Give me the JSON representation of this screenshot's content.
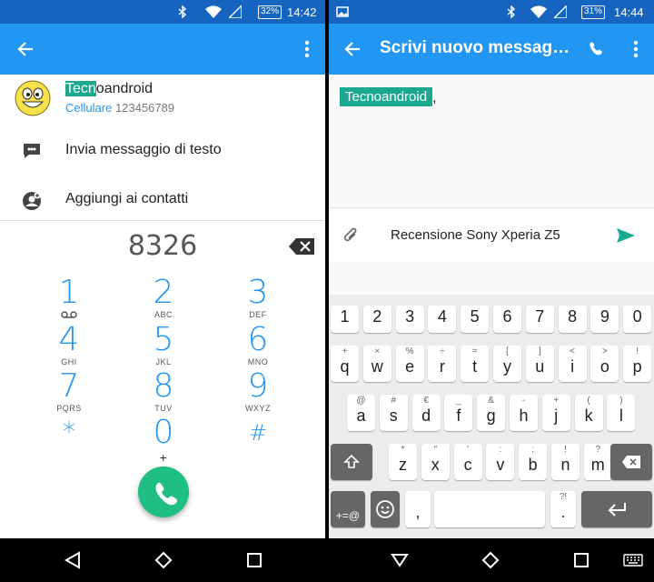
{
  "left": {
    "status": {
      "battery": "32%",
      "time": "14:42"
    },
    "contact": {
      "name_highlight": "Tecn",
      "name_rest": "oandroid",
      "type": "Cellulare",
      "number": "123456789"
    },
    "actions": [
      {
        "label": "Invia messaggio di testo"
      },
      {
        "label": "Aggiungi ai contatti"
      }
    ],
    "dialed": "8326",
    "keys": [
      {
        "digit": "1",
        "letters": ""
      },
      {
        "digit": "2",
        "letters": "ABC"
      },
      {
        "digit": "3",
        "letters": "DEF"
      },
      {
        "digit": "4",
        "letters": "GHI"
      },
      {
        "digit": "5",
        "letters": "JKL"
      },
      {
        "digit": "6",
        "letters": "MNO"
      },
      {
        "digit": "7",
        "letters": "PQRS"
      },
      {
        "digit": "8",
        "letters": "TUV"
      },
      {
        "digit": "9",
        "letters": "WXYZ"
      },
      {
        "digit": "*",
        "letters": ""
      },
      {
        "digit": "0",
        "letters": "+"
      },
      {
        "digit": "#",
        "letters": ""
      }
    ]
  },
  "right": {
    "status": {
      "battery": "31%",
      "time": "14:44"
    },
    "title": "Scrivi nuovo messag…",
    "recipient": "Tecnoandroid",
    "recipient_sep": ",",
    "message": "Recensione Sony Xperia Z5",
    "keyboard": {
      "numbers": [
        "1",
        "2",
        "3",
        "4",
        "5",
        "6",
        "7",
        "8",
        "9",
        "0"
      ],
      "row1": [
        [
          "q",
          "+"
        ],
        [
          "w",
          "×"
        ],
        [
          "e",
          "%"
        ],
        [
          "r",
          "÷"
        ],
        [
          "t",
          "="
        ],
        [
          "y",
          "["
        ],
        [
          "u",
          "]"
        ],
        [
          "i",
          "<"
        ],
        [
          "o",
          ">"
        ],
        [
          "p",
          "!"
        ]
      ],
      "row2": [
        [
          "a",
          "@"
        ],
        [
          "s",
          "#"
        ],
        [
          "d",
          "€"
        ],
        [
          "f",
          "_"
        ],
        [
          "g",
          "&"
        ],
        [
          "h",
          "-"
        ],
        [
          "j",
          "+"
        ],
        [
          "k",
          "("
        ],
        [
          "l",
          ")"
        ]
      ],
      "row3": [
        [
          "z",
          "*"
        ],
        [
          "x",
          "\""
        ],
        [
          "c",
          "'"
        ],
        [
          "v",
          ":"
        ],
        [
          "b",
          ";"
        ],
        [
          "n",
          "!"
        ],
        [
          "m",
          "?"
        ]
      ],
      "symbols_label": "+=@",
      "comma": ",",
      "period": ".",
      "period_sub": "?!"
    }
  },
  "colors": {
    "appbar": "#2196f3",
    "statusbar": "#1565c0",
    "accent": "#1aa98f",
    "fab": "#1fbf83"
  }
}
